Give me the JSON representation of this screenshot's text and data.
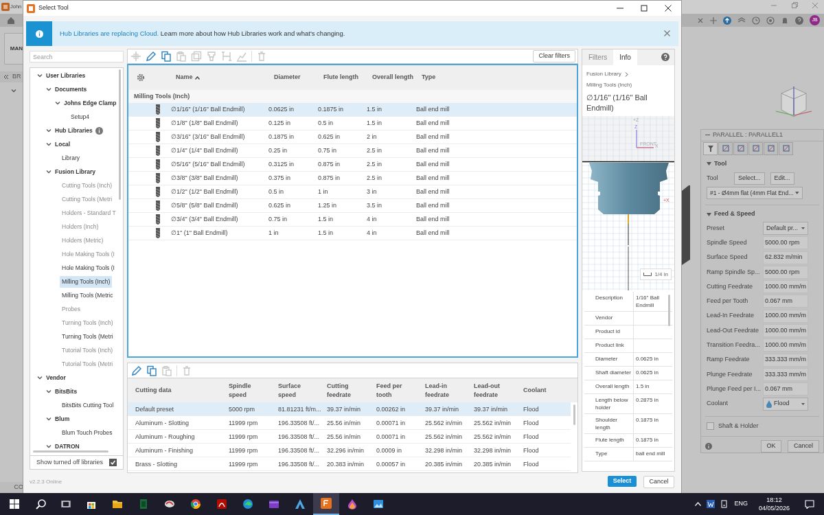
{
  "background_app": {
    "title": "John",
    "left_buttons": [
      "MAN",
      "BR",
      "CO"
    ],
    "avatar": "JB",
    "panel": {
      "title": "PARALLEL : PARALLEL1",
      "tool_section": "Tool",
      "tool_label": "Tool",
      "tool_buttons": [
        "Select...",
        "Edit..."
      ],
      "tool_value": "#1 - Ø4mm flat (4mm Flat End...",
      "feed_section": "Feed & Speed",
      "fields": [
        {
          "label": "Preset",
          "value": "Default pr...",
          "kind": "dropdown"
        },
        {
          "label": "Spindle Speed",
          "value": "5000.00 rpm",
          "kind": "text"
        },
        {
          "label": "Surface Speed",
          "value": "62.832 m/min",
          "kind": "text"
        },
        {
          "label": "Ramp Spindle Sp...",
          "value": "5000.00 rpm",
          "kind": "text"
        },
        {
          "label": "Cutting Feedrate",
          "value": "1000.00 mm/m",
          "kind": "text"
        },
        {
          "label": "Feed per Tooth",
          "value": "0.067 mm",
          "kind": "text"
        },
        {
          "label": "Lead-In Feedrate",
          "value": "1000.00 mm/m",
          "kind": "text"
        },
        {
          "label": "Lead-Out Feedrate",
          "value": "1000.00 mm/m",
          "kind": "text"
        },
        {
          "label": "Transition Feedra...",
          "value": "1000.00 mm/m",
          "kind": "text"
        },
        {
          "label": "Ramp Feedrate",
          "value": "333.333 mm/m",
          "kind": "text"
        },
        {
          "label": "Plunge Feedrate",
          "value": "333.333 mm/m",
          "kind": "text"
        },
        {
          "label": "Plunge Feed per I...",
          "value": "0.067 mm",
          "kind": "text"
        },
        {
          "label": "Coolant",
          "value": "Flood",
          "kind": "coolant"
        }
      ],
      "shaft_holder": {
        "label": "Shaft & Holder",
        "checked": false
      },
      "buttons": [
        "OK",
        "Cancel"
      ]
    }
  },
  "dialog": {
    "title": "Select Tool",
    "banner": {
      "link": "Hub Libraries are replacing Cloud.",
      "text": "Learn more about how Hub Libraries work and what's changing."
    },
    "search": {
      "placeholder": "Search"
    },
    "tree": [
      {
        "label": "User Libraries",
        "expanded": true,
        "dimmed": false,
        "selected": false,
        "children": [
          {
            "label": "Documents",
            "expanded": true,
            "dimmed": false,
            "selected": false,
            "children": [
              {
                "label": "Johns Edge Clamp",
                "expanded": true,
                "dimmed": false,
                "selected": false,
                "children": [
                  {
                    "label": "Setup4",
                    "dimmed": false,
                    "selected": false
                  }
                ]
              }
            ]
          },
          {
            "label": "Hub Libraries",
            "expanded": true,
            "dimmed": false,
            "selected": false,
            "info": true
          },
          {
            "label": "Local",
            "expanded": true,
            "dimmed": false,
            "selected": false,
            "children": [
              {
                "label": "Library",
                "dimmed": false,
                "selected": false
              }
            ]
          },
          {
            "label": "Fusion Library",
            "expanded": true,
            "dimmed": false,
            "selected": false,
            "children": [
              {
                "label": "Cutting Tools (Inch)",
                "dimmed": true,
                "selected": false
              },
              {
                "label": "Cutting Tools (Metri",
                "dimmed": true,
                "selected": false
              },
              {
                "label": "Holders - Standard T",
                "dimmed": true,
                "selected": false
              },
              {
                "label": "Holders (Inch)",
                "dimmed": true,
                "selected": false
              },
              {
                "label": "Holders (Metric)",
                "dimmed": true,
                "selected": false
              },
              {
                "label": "Hole Making Tools (I",
                "dimmed": true,
                "selected": false
              },
              {
                "label": "Hole Making Tools (I",
                "dimmed": false,
                "selected": false
              },
              {
                "label": "Milling Tools (Inch)",
                "dimmed": false,
                "selected": true
              },
              {
                "label": "Milling Tools (Metric",
                "dimmed": false,
                "selected": false
              },
              {
                "label": "Probes",
                "dimmed": true,
                "selected": false
              },
              {
                "label": "Turning Tools (Inch)",
                "dimmed": true,
                "selected": false
              },
              {
                "label": "Turning Tools (Metri",
                "dimmed": false,
                "selected": false
              },
              {
                "label": "Tutorial Tools (Inch)",
                "dimmed": true,
                "selected": false
              },
              {
                "label": "Tutorial Tools (Metri",
                "dimmed": true,
                "selected": false
              }
            ]
          }
        ]
      },
      {
        "label": "Vendor",
        "expanded": true,
        "dimmed": false,
        "selected": false,
        "children": [
          {
            "label": "BitsBits",
            "expanded": true,
            "dimmed": false,
            "selected": false,
            "children": [
              {
                "label": "BitsBits Cutting Tool",
                "dimmed": false,
                "selected": false
              }
            ]
          },
          {
            "label": "Blum",
            "expanded": true,
            "dimmed": false,
            "selected": false,
            "children": [
              {
                "label": "Blum Touch Probes",
                "dimmed": false,
                "selected": false
              }
            ]
          },
          {
            "label": "DATRON",
            "expanded": true,
            "dimmed": false,
            "selected": false
          }
        ]
      }
    ],
    "show_turned_off": {
      "label": "Show turned off libraries",
      "checked": true
    },
    "toolbar": [
      {
        "kind": "add",
        "disabled": true
      },
      {
        "kind": "edit",
        "disabled": false
      },
      {
        "kind": "copy",
        "disabled": false
      },
      {
        "kind": "paste",
        "disabled": true
      },
      {
        "kind": "duplicate",
        "disabled": true
      },
      {
        "kind": "holder",
        "disabled": true
      },
      {
        "kind": "measure",
        "disabled": true
      },
      {
        "kind": "chart",
        "disabled": true
      },
      {
        "kind": "delete",
        "disabled": true
      }
    ],
    "clear_filters": "Clear filters",
    "tools_table": {
      "columns": [
        "Name",
        "Diameter",
        "Flute length",
        "Overall length",
        "Type"
      ],
      "group": "Milling Tools (Inch)",
      "rows": [
        {
          "name": "∅1/16\" (1/16\" Ball Endmill)",
          "diameter": "0.0625 in",
          "flute_length": "0.1875 in",
          "overall_length": "1.5 in",
          "type": "Ball end mill",
          "selected": true
        },
        {
          "name": "∅1/8\" (1/8\" Ball Endmill)",
          "diameter": "0.125 in",
          "flute_length": "0.5 in",
          "overall_length": "1.5 in",
          "type": "Ball end mill",
          "selected": false
        },
        {
          "name": "∅3/16\" (3/16\" Ball Endmill)",
          "diameter": "0.1875 in",
          "flute_length": "0.625 in",
          "overall_length": "2 in",
          "type": "Ball end mill",
          "selected": false
        },
        {
          "name": "∅1/4\" (1/4\" Ball Endmill)",
          "diameter": "0.25 in",
          "flute_length": "0.75 in",
          "overall_length": "2.5 in",
          "type": "Ball end mill",
          "selected": false
        },
        {
          "name": "∅5/16\" (5/16\" Ball Endmill)",
          "diameter": "0.3125 in",
          "flute_length": "0.875 in",
          "overall_length": "2.5 in",
          "type": "Ball end mill",
          "selected": false
        },
        {
          "name": "∅3/8\" (3/8\" Ball Endmill)",
          "diameter": "0.375 in",
          "flute_length": "0.875 in",
          "overall_length": "2.5 in",
          "type": "Ball end mill",
          "selected": false
        },
        {
          "name": "∅1/2\" (1/2\" Ball Endmill)",
          "diameter": "0.5 in",
          "flute_length": "1 in",
          "overall_length": "3 in",
          "type": "Ball end mill",
          "selected": false
        },
        {
          "name": "∅5/8\" (5/8\" Ball Endmill)",
          "diameter": "0.625 in",
          "flute_length": "1.25 in",
          "overall_length": "3.5 in",
          "type": "Ball end mill",
          "selected": false
        },
        {
          "name": "∅3/4\" (3/4\" Ball Endmill)",
          "diameter": "0.75 in",
          "flute_length": "1.5 in",
          "overall_length": "4 in",
          "type": "Ball end mill",
          "selected": false
        },
        {
          "name": "∅1\" (1\" Ball Endmill)",
          "diameter": "1 in",
          "flute_length": "1.5 in",
          "overall_length": "4 in",
          "type": "Ball end mill",
          "selected": false
        }
      ]
    },
    "cutting_toolbar": [
      {
        "kind": "edit",
        "disabled": false
      },
      {
        "kind": "copy",
        "disabled": false
      },
      {
        "kind": "paste",
        "disabled": true
      },
      {
        "kind": "delete",
        "disabled": true
      }
    ],
    "cutting_table": {
      "columns": [
        "Cutting data",
        "Spindle speed",
        "Surface speed",
        "Cutting feedrate",
        "Feed per tooth",
        "Lead-in feedrate",
        "Lead-out feedrate",
        "Coolant"
      ],
      "rows": [
        {
          "cells": [
            "Default preset",
            "5000 rpm",
            "81.81231 ft/m...",
            "39.37 in/min",
            "0.00262 in",
            "39.37 in/min",
            "39.37 in/min",
            "Flood"
          ],
          "selected": true
        },
        {
          "cells": [
            "Aluminum - Slotting",
            "11999 rpm",
            "196.33508 ft/...",
            "25.56 in/min",
            "0.00071 in",
            "25.562 in/min",
            "25.562 in/min",
            "Flood"
          ],
          "selected": false
        },
        {
          "cells": [
            "Aluminum - Roughing",
            "11999 rpm",
            "196.33508 ft/...",
            "25.56 in/min",
            "0.00071 in",
            "25.562 in/min",
            "25.562 in/min",
            "Flood"
          ],
          "selected": false
        },
        {
          "cells": [
            "Aluminum - Finishing",
            "11999 rpm",
            "196.33508 ft/...",
            "32.296 in/min",
            "0.0009 in",
            "32.298 in/min",
            "32.298 in/min",
            "Flood"
          ],
          "selected": false
        },
        {
          "cells": [
            "Brass - Slotting",
            "11999 rpm",
            "196.33508 ft/...",
            "20.383 in/min",
            "0.00057 in",
            "20.385 in/min",
            "20.385 in/min",
            "Flood"
          ],
          "selected": false
        }
      ]
    },
    "info_panel": {
      "tabs": [
        {
          "label": "Filters",
          "selected": false
        },
        {
          "label": "Info",
          "selected": true
        }
      ],
      "breadcrumb": [
        "Fusion Library",
        "Milling Tools (Inch)"
      ],
      "title": "∅1/16\" (1/16\" Ball Endmill)",
      "preview_labels": {
        "top_z": "+Z",
        "axis_z": "Z",
        "view": "FRONT",
        "axis_x": "X",
        "plus_x": "+X",
        "scale": "1/4 in"
      },
      "properties": [
        {
          "label": "Description",
          "value": "1/16\" Ball Endmill"
        },
        {
          "label": "Vendor"
        },
        {
          "label": "Product id"
        },
        {
          "label": "Product link"
        },
        {
          "label": "Diameter",
          "value": "0.0625 in"
        },
        {
          "label": "Shaft diameter",
          "value": "0.0625 in"
        },
        {
          "label": "Overall length",
          "value": "1.5 in"
        },
        {
          "label": "Length below holder",
          "value": "0.2875 in"
        },
        {
          "label": "Shoulder length",
          "value": "0.1875 in"
        },
        {
          "label": "Flute length",
          "value": "0.1875 in"
        },
        {
          "label": "Type",
          "value": "ball end mill"
        }
      ]
    },
    "version": "v2.2.3 Online",
    "buttons": [
      "Select",
      "Cancel"
    ]
  },
  "taskbar": {
    "language": "ENG",
    "time": "18:12",
    "date": "04/05/2026"
  }
}
